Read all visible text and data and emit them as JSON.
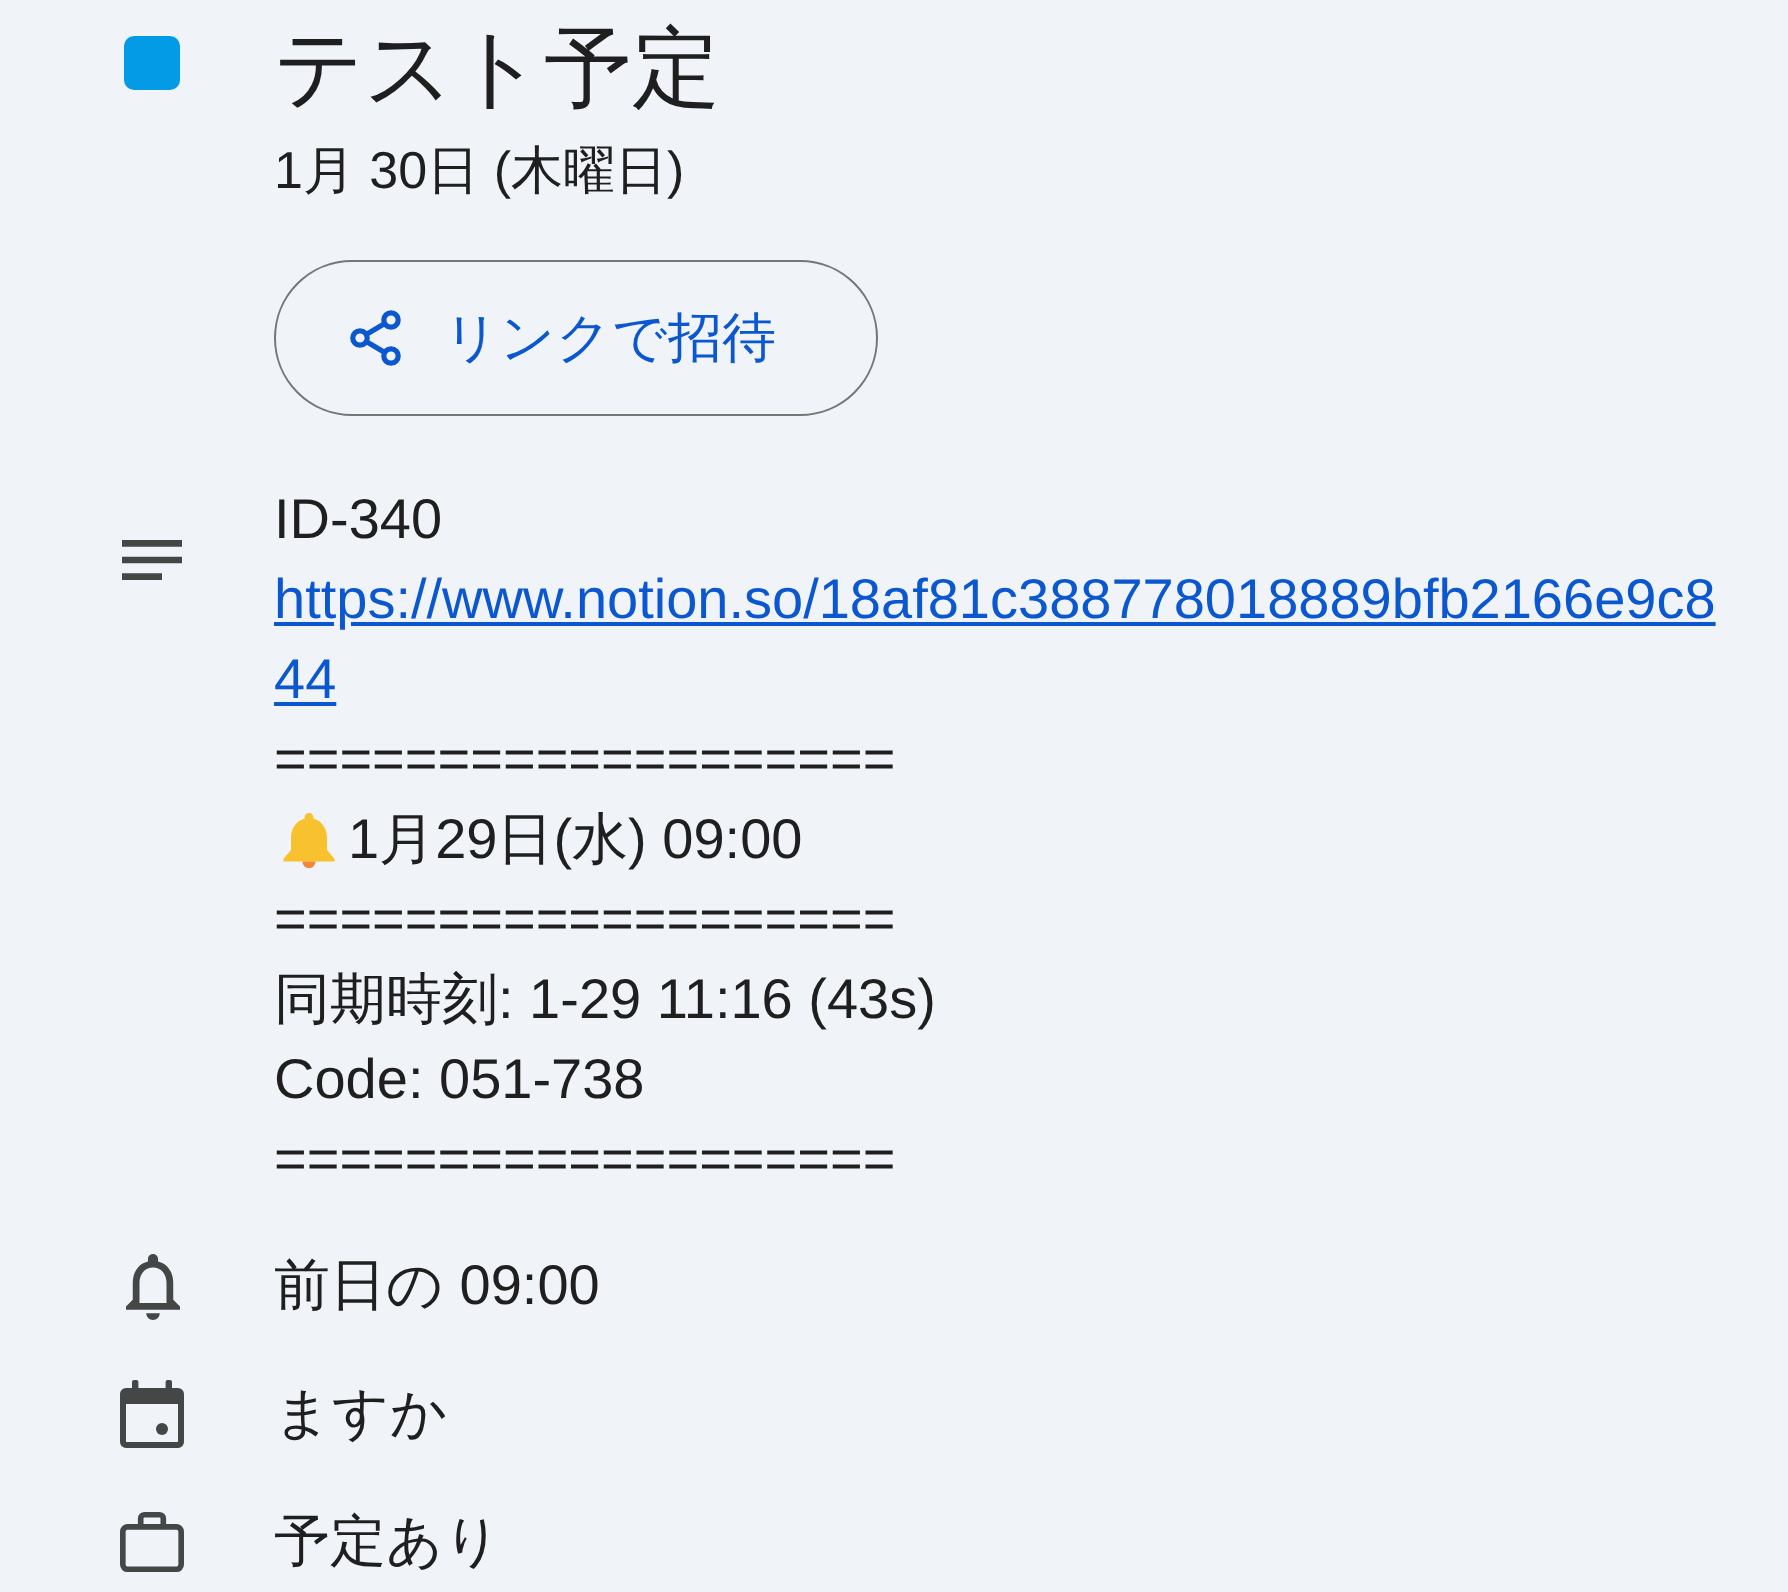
{
  "event": {
    "color": "#039be5",
    "title": "テスト予定",
    "date": "1月 30日 (木曜日)"
  },
  "invite_button": {
    "label": "リンクで招待"
  },
  "description": {
    "lines": [
      {
        "kind": "text",
        "text": "ID-340"
      },
      {
        "kind": "link",
        "text": "https://www.notion.so/18af81c388778018889bfb2166e9c844"
      },
      {
        "kind": "separator",
        "text": "==================="
      },
      {
        "kind": "reminder",
        "text": "1月29日(水) 09:00"
      },
      {
        "kind": "separator",
        "text": "==================="
      },
      {
        "kind": "text",
        "text": "同期時刻: 1-29 11:16 (43s)"
      },
      {
        "kind": "text",
        "text": "Code: 051-738"
      },
      {
        "kind": "separator",
        "text": "==================="
      }
    ]
  },
  "details": [
    {
      "kind": "notification",
      "text": "前日の 09:00"
    },
    {
      "kind": "calendar",
      "text": "ますか"
    },
    {
      "kind": "availability",
      "text": "予定あり"
    }
  ]
}
